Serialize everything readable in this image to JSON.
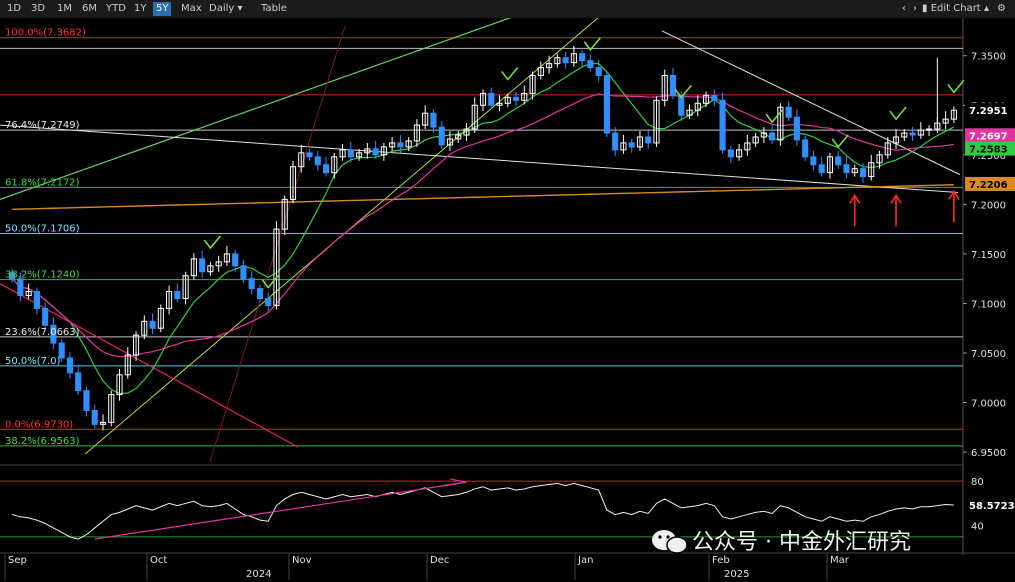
{
  "toolbar": {
    "ranges": [
      "1D",
      "3D",
      "1M",
      "6M",
      "YTD",
      "1Y",
      "5Y",
      "Max"
    ],
    "active_range": "5Y",
    "interval": "Daily",
    "interval_arrow": "▾",
    "table_label": "Table",
    "edit_label": "Edit Chart",
    "icons": [
      "plus-icon",
      "pencil-icon",
      "expand-icon",
      "gear-icon"
    ]
  },
  "watermark": {
    "text": "公众号 · 中金外汇研究",
    "icon": "wechat-icon"
  },
  "colors": {
    "up": "#ffffff",
    "down": "#2f8fff",
    "ma_green": "#2ecc40",
    "ma_pink": "#e0359e",
    "ma_orange": "#d98a1f",
    "trend_green": "#5fd35f",
    "trend_red": "#e0245e",
    "trend_white": "#e0e0e0"
  },
  "chart_data": {
    "type": "candlestick",
    "ylim": [
      6.94,
      7.38
    ],
    "yticks": [
      6.95,
      7.0,
      7.05,
      7.1,
      7.15,
      7.2,
      7.25,
      7.3,
      7.35
    ],
    "xlabels_month": [
      "Sep",
      "Oct",
      "Nov",
      "Dec",
      "Jan",
      "Feb",
      "Mar"
    ],
    "xlabels_year": [
      "2024",
      "2025"
    ],
    "fib_levels": [
      {
        "label": "100.0%(7.3682)",
        "value": 7.3682,
        "color": "#ff3030"
      },
      {
        "label": "76.4%(7.2749)",
        "value": 7.2749,
        "color": "#e8e8e8"
      },
      {
        "label": "61.8%(7.2172)",
        "value": 7.2172,
        "color": "#3ddc3d"
      },
      {
        "label": "50.0%(7.1706)",
        "value": 7.1706,
        "color": "#6fe8ff"
      },
      {
        "label": "38.2%(7.1240)",
        "value": 7.124,
        "color": "#3ddc3d"
      },
      {
        "label": "23.6%(7.0663)",
        "value": 7.0663,
        "color": "#e8e8e8"
      },
      {
        "label": "0.0%(6.9730)",
        "value": 6.973,
        "color": "#ff3030"
      },
      {
        "label": "38.2%(6.9563)",
        "value": 6.9563,
        "color": "#3ddc3d"
      },
      {
        "label": "50.0%(7.0)",
        "value": 7.037,
        "color": "#6fe8ff"
      }
    ],
    "hlines": [
      7.3682,
      7.3574,
      7.3105,
      7.2749,
      7.2172,
      7.1706,
      7.124,
      7.0663,
      6.973
    ],
    "last_tags": [
      {
        "value": "7.2951",
        "price": 7.2951,
        "bg": "#000000",
        "fg": "#ffffff"
      },
      {
        "value": "7.2697",
        "price": 7.2697,
        "bg": "#e0359e",
        "fg": "#ffffff"
      },
      {
        "value": "7.2583",
        "price": 7.2583,
        "bg": "#2ecc40",
        "fg": "#000000"
      },
      {
        "value": "7.2206",
        "price": 7.2206,
        "bg": "#d98a1f",
        "fg": "#000000"
      }
    ],
    "closes": [
      7.125,
      7.108,
      7.112,
      7.095,
      7.078,
      7.06,
      7.045,
      7.03,
      7.012,
      6.992,
      6.978,
      6.98,
      7.008,
      7.028,
      7.048,
      7.068,
      7.082,
      7.075,
      7.095,
      7.112,
      7.105,
      7.128,
      7.145,
      7.132,
      7.138,
      7.142,
      7.15,
      7.138,
      7.125,
      7.115,
      7.105,
      7.098,
      7.175,
      7.205,
      7.238,
      7.252,
      7.248,
      7.24,
      7.232,
      7.248,
      7.255,
      7.248,
      7.252,
      7.256,
      7.25,
      7.258,
      7.262,
      7.258,
      7.264,
      7.28,
      7.292,
      7.278,
      7.26,
      7.266,
      7.27,
      7.276,
      7.3,
      7.312,
      7.3,
      7.302,
      7.308,
      7.305,
      7.312,
      7.33,
      7.338,
      7.342,
      7.348,
      7.343,
      7.352,
      7.345,
      7.338,
      7.33,
      7.272,
      7.255,
      7.262,
      7.258,
      7.268,
      7.262,
      7.305,
      7.33,
      7.31,
      7.29,
      7.295,
      7.302,
      7.31,
      7.305,
      7.255,
      7.248,
      7.255,
      7.262,
      7.268,
      7.272,
      7.265,
      7.298,
      7.288,
      7.265,
      7.248,
      7.24,
      7.232,
      7.248,
      7.24,
      7.232,
      7.236,
      7.228,
      7.242,
      7.25,
      7.262,
      7.268,
      7.272,
      7.27,
      7.275,
      7.276,
      7.282,
      7.286,
      7.295
    ],
    "rsi": {
      "ylim": [
        20,
        90
      ],
      "ticks": [
        40,
        80
      ],
      "last": "58.5723",
      "values": [
        50,
        48,
        47,
        45,
        42,
        38,
        34,
        30,
        28,
        32,
        38,
        44,
        50,
        52,
        55,
        58,
        56,
        54,
        57,
        60,
        58,
        60,
        62,
        58,
        57,
        58,
        60,
        55,
        50,
        48,
        45,
        44,
        58,
        64,
        68,
        70,
        68,
        66,
        64,
        66,
        68,
        66,
        67,
        68,
        66,
        68,
        70,
        68,
        70,
        72,
        74,
        70,
        66,
        67,
        68,
        70,
        73,
        75,
        72,
        73,
        74,
        72,
        73,
        75,
        76,
        77,
        78,
        76,
        78,
        76,
        74,
        72,
        54,
        50,
        52,
        50,
        53,
        51,
        60,
        64,
        60,
        56,
        57,
        58,
        60,
        58,
        48,
        46,
        48,
        50,
        52,
        53,
        51,
        58,
        56,
        52,
        48,
        46,
        44,
        48,
        46,
        44,
        45,
        44,
        48,
        50,
        53,
        55,
        56,
        55,
        57,
        57,
        58,
        59,
        58.57
      ]
    }
  }
}
